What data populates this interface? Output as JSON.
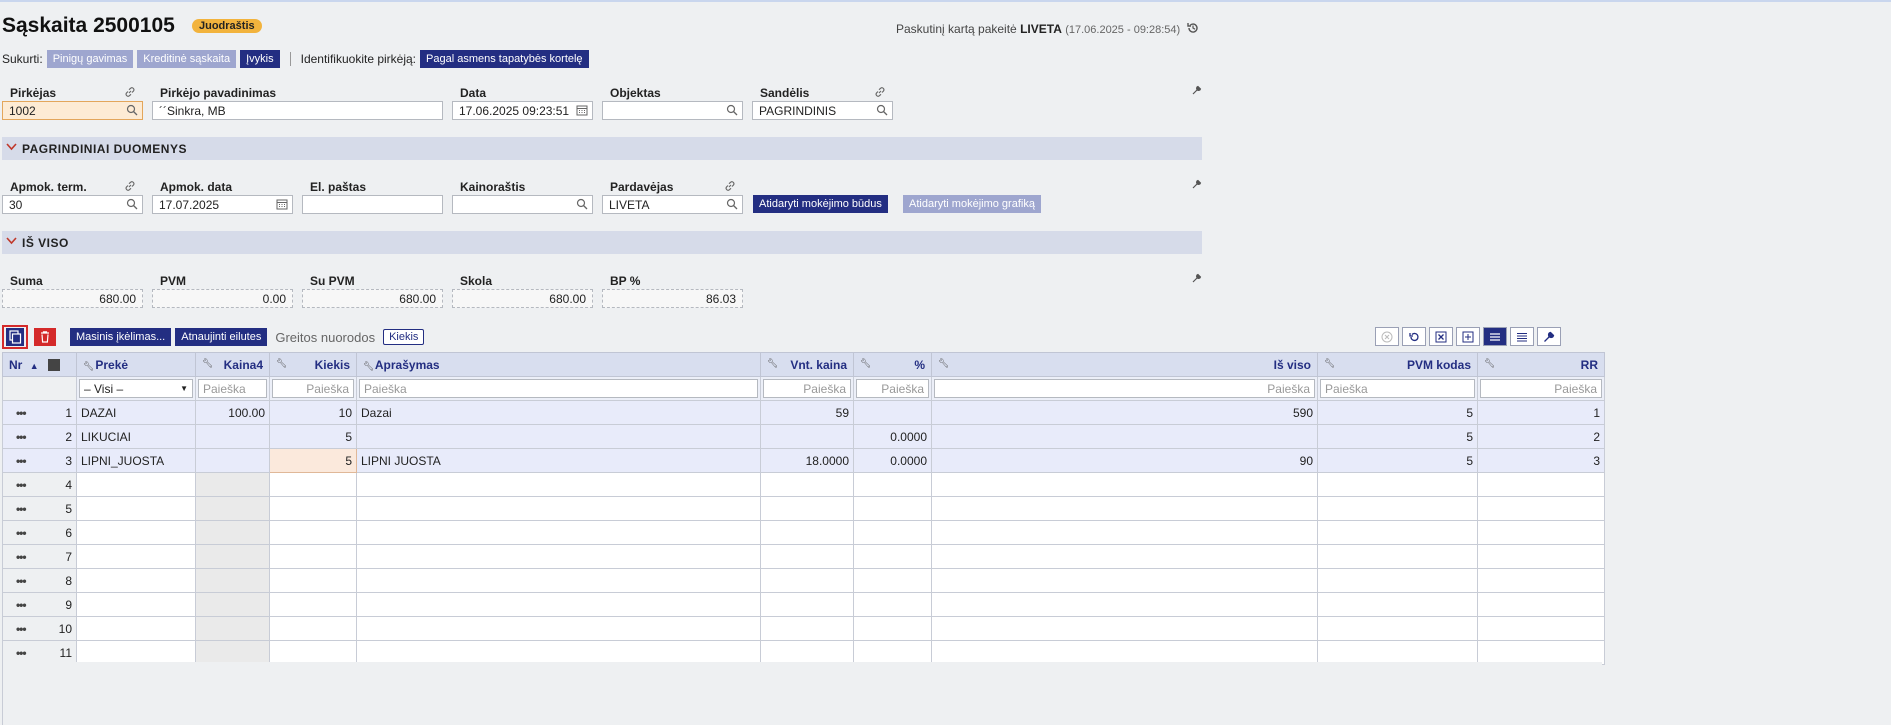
{
  "header": {
    "title": "Sąskaita 2500105",
    "status": "Juodraštis",
    "last_modified_prefix": "Paskutinį kartą pakeitė",
    "last_modified_user": "LIVETA",
    "last_modified_time": "(17.06.2025 - 09:28:54)"
  },
  "create_row": {
    "label": "Sukurti:",
    "btn_payment": "Pinigų gavimas",
    "btn_credit": "Kreditinė sąskaita",
    "btn_event": "Įvykis",
    "identify_label": "Identifikuokite pirkėją:",
    "btn_identify": "Pagal asmens tapatybės kortelę"
  },
  "fields": {
    "buyer_label": "Pirkėjas",
    "buyer_value": "1002",
    "buyer_name_label": "Pirkėjo pavadinimas",
    "buyer_name_value": "´´Sinkra, MB",
    "date_label": "Data",
    "date_value": "17.06.2025 09:23:51",
    "object_label": "Objektas",
    "object_value": "",
    "warehouse_label": "Sandėlis",
    "warehouse_value": "PAGRINDINIS"
  },
  "section_main": "PAGRINDINIAI DUOMENYS",
  "main_fields": {
    "pay_term_label": "Apmok. term.",
    "pay_term_value": "30",
    "pay_date_label": "Apmok. data",
    "pay_date_value": "17.07.2025",
    "email_label": "El. paštas",
    "email_value": "",
    "pricelist_label": "Kainoraštis",
    "pricelist_value": "",
    "seller_label": "Pardavėjas",
    "seller_value": "LIVETA",
    "btn_payment_methods": "Atidaryti mokėjimo būdus",
    "btn_payment_schedule": "Atidaryti mokėjimo grafiką"
  },
  "section_total": "IŠ VISO",
  "totals": {
    "sum_label": "Suma",
    "sum_value": "680.00",
    "vat_label": "PVM",
    "vat_value": "0.00",
    "with_vat_label": "Su PVM",
    "with_vat_value": "680.00",
    "debt_label": "Skola",
    "debt_value": "680.00",
    "bp_label": "BP %",
    "bp_value": "86.03"
  },
  "toolbar": {
    "btn_mass": "Masinis įkėlimas...",
    "btn_refresh": "Atnaujinti eilutes",
    "quick_links": "Greitos nuorodos",
    "btn_qty": "Kiekis"
  },
  "table": {
    "headers": {
      "nr": "Nr",
      "item": "Prekė",
      "price4": "Kaina4",
      "qty": "Kiekis",
      "desc": "Aprašymas",
      "unit_price": "Vnt. kaina",
      "pct": "%",
      "total": "Iš viso",
      "vat_code": "PVM kodas",
      "rr": "RR"
    },
    "filter": {
      "all": "– Visi –",
      "search": "Paieška"
    },
    "rows": [
      {
        "nr": "1",
        "item": "DAZAI",
        "price4": "100.00",
        "qty": "10",
        "desc": "Dazai",
        "unit_price": "59",
        "pct": "",
        "total": "590",
        "vat": "5",
        "rr": "1"
      },
      {
        "nr": "2",
        "item": "LIKUCIAI",
        "price4": "",
        "qty": "5",
        "desc": "",
        "unit_price": "",
        "pct": "0.0000",
        "total": "",
        "vat": "5",
        "rr": "2"
      },
      {
        "nr": "3",
        "item": "LIPNI_JUOSTA",
        "price4": "",
        "qty": "5",
        "desc": "LIPNI JUOSTA",
        "unit_price": "18.0000",
        "pct": "0.0000",
        "total": "90",
        "vat": "5",
        "rr": "3"
      },
      {
        "nr": "4"
      },
      {
        "nr": "5"
      },
      {
        "nr": "6"
      },
      {
        "nr": "7"
      },
      {
        "nr": "8"
      },
      {
        "nr": "9"
      },
      {
        "nr": "10"
      },
      {
        "nr": "11"
      }
    ]
  },
  "colors": {
    "primary": "#232e82",
    "accent_light": "#9ea6cf",
    "badge": "#f2b33d",
    "delete": "#d42a2a"
  }
}
